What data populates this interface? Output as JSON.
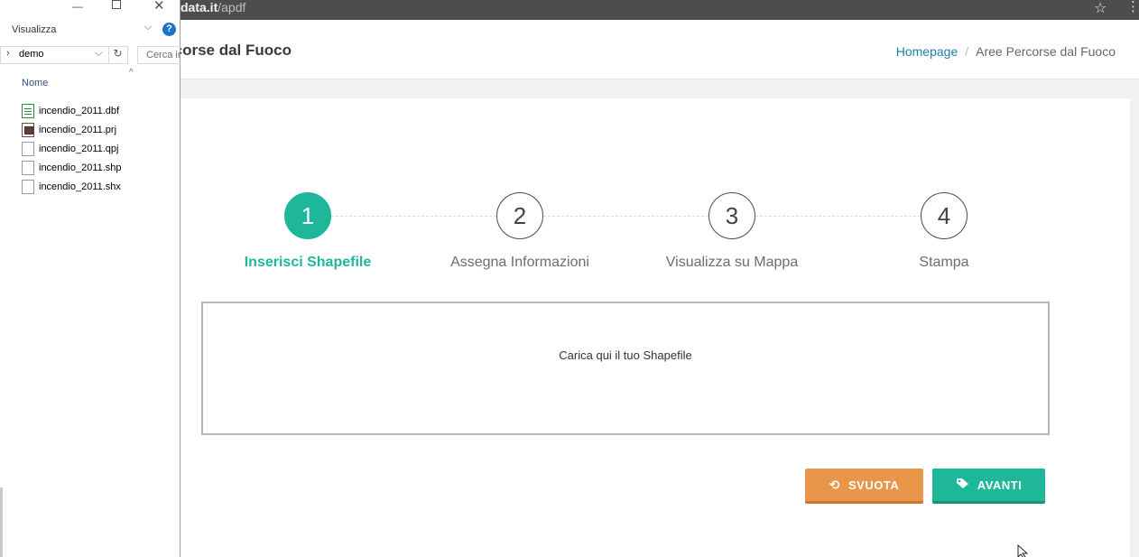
{
  "browser": {
    "url_host": "data.it",
    "url_path": "/apdf",
    "star_icon": "star-icon",
    "menu_icon": "kebab-icon"
  },
  "page": {
    "title": "rcorse dal Fuoco",
    "breadcrumb": {
      "home": "Homepage",
      "separator": "/",
      "current": "Aree Percorse dal Fuoco"
    }
  },
  "wizard": {
    "active_color": "#1fb799",
    "steps": [
      {
        "number": "1",
        "label": "Inserisci Shapefile",
        "active": true
      },
      {
        "number": "2",
        "label": "Assegna Informazioni",
        "active": false
      },
      {
        "number": "3",
        "label": "Visualizza su Mappa",
        "active": false
      },
      {
        "number": "4",
        "label": "Stampa",
        "active": false
      }
    ]
  },
  "dropzone": {
    "text": "Carica qui il tuo Shapefile"
  },
  "buttons": {
    "clear": {
      "label": "SVUOTA",
      "icon": "undo-icon",
      "color": "#e8964a"
    },
    "next": {
      "label": "AVANTI",
      "icon": "tag-icon",
      "color": "#1fb799"
    }
  },
  "explorer": {
    "ribbon_tab": "Visualizza",
    "path": "demo",
    "search_placeholder": "Cerca in demo",
    "column_header": "Nome",
    "files": [
      {
        "name": "incendio_2011.dbf",
        "type": "dbf"
      },
      {
        "name": "incendio_2011.prj",
        "type": "prj"
      },
      {
        "name": "incendio_2011.qpj",
        "type": "generic"
      },
      {
        "name": "incendio_2011.shp",
        "type": "generic"
      },
      {
        "name": "incendio_2011.shx",
        "type": "generic"
      }
    ]
  }
}
